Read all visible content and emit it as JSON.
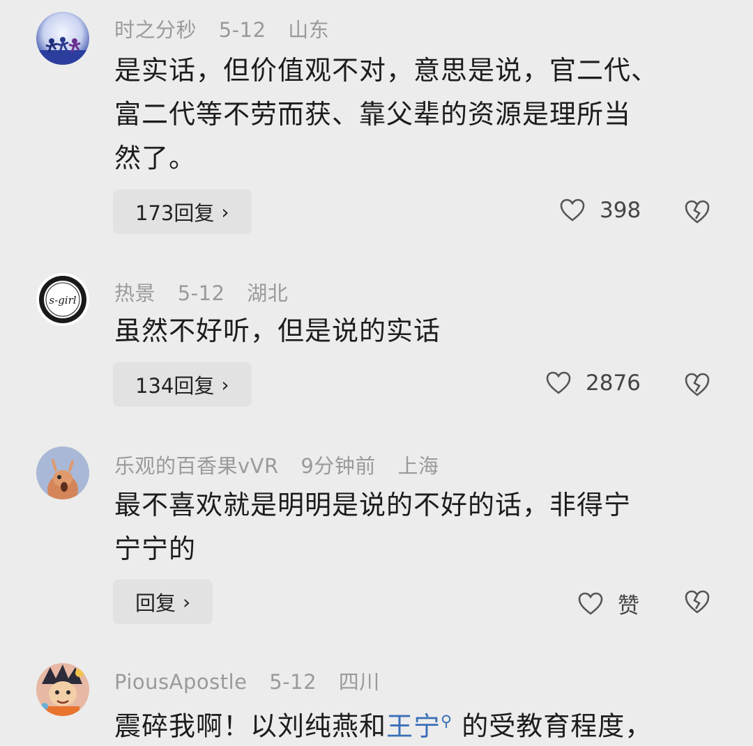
{
  "comments": [
    {
      "username": "时之分秒",
      "date": "5-12",
      "location": "山东",
      "text": "是实话，但价值观不对，意思是说，官二代、富二代等不劳而获、靠父辈的资源是理所当然了。",
      "lines": [
        "是实话，但价值观不对，意思是说，官二代、",
        "富二代等不劳而获、靠父辈的资源是理所当",
        "然了。"
      ],
      "reply_label": "173回复",
      "like_count": "398",
      "avatar_icon": "runners-avatar"
    },
    {
      "username": "热景",
      "date": "5-12",
      "location": "湖北",
      "lines": [
        "虽然不好听，但是说的实话"
      ],
      "reply_label": "134回复",
      "like_count": "2876",
      "avatar_icon": "s-girl-badge-avatar"
    },
    {
      "username": "乐观的百香果vVR",
      "date": "9分钟前",
      "location": "上海",
      "lines": [
        "最不喜欢就是明明是说的不好的话，非得宁",
        "宁宁的"
      ],
      "reply_label": "回复",
      "like_count": "赞",
      "avatar_icon": "cartoon-creature-avatar"
    },
    {
      "username": "PiousApostle",
      "date": "5-12",
      "location": "四川",
      "line_before": "震碎我啊！以刘纯燕和",
      "mention": "王宁",
      "mention_icon": "search-icon",
      "line_after": " 的受教育程度，",
      "avatar_icon": "anime-character-avatar"
    }
  ],
  "colors": {
    "background": "#ececec",
    "meta_text": "#9a9a9a",
    "pill_bg": "#e2e2e2",
    "mention": "#3a6fb7"
  },
  "reply_chevron": "›"
}
